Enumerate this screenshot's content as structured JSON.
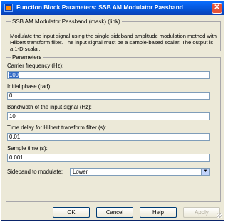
{
  "window": {
    "title": "Function Block Parameters: SSB AM Modulator Passband",
    "close_glyph": "✕"
  },
  "mask": {
    "legend": "SSB AM Modulator Passband (mask) (link)",
    "description": "Modulate the input signal using the single-sideband amplitude modulation method with Hilbert transform filter. The input signal must be a sample-based scalar. The output is a 1-D scalar."
  },
  "params": {
    "legend": "Parameters",
    "carrier_frequency": {
      "label": "Carrier frequency (Hz):",
      "value": "100"
    },
    "initial_phase": {
      "label": "Initial phase (rad):",
      "value": "0"
    },
    "bandwidth": {
      "label": "Bandwidth of the input signal (Hz):",
      "value": "10"
    },
    "time_delay": {
      "label": "Time delay for Hilbert transform filter (s):",
      "value": "0.01"
    },
    "sample_time": {
      "label": "Sample time (s):",
      "value": "0.001"
    },
    "sideband": {
      "label": "Sideband to modulate:",
      "value": "Lower"
    }
  },
  "buttons": {
    "ok": {
      "label": "OK"
    },
    "cancel": {
      "label": "Cancel"
    },
    "help": {
      "label": "Help"
    },
    "apply": {
      "label": "Apply"
    }
  },
  "icons": [
    "simulink-icon",
    "close-icon",
    "dropdown-arrow-icon",
    "resize-grip-icon"
  ]
}
